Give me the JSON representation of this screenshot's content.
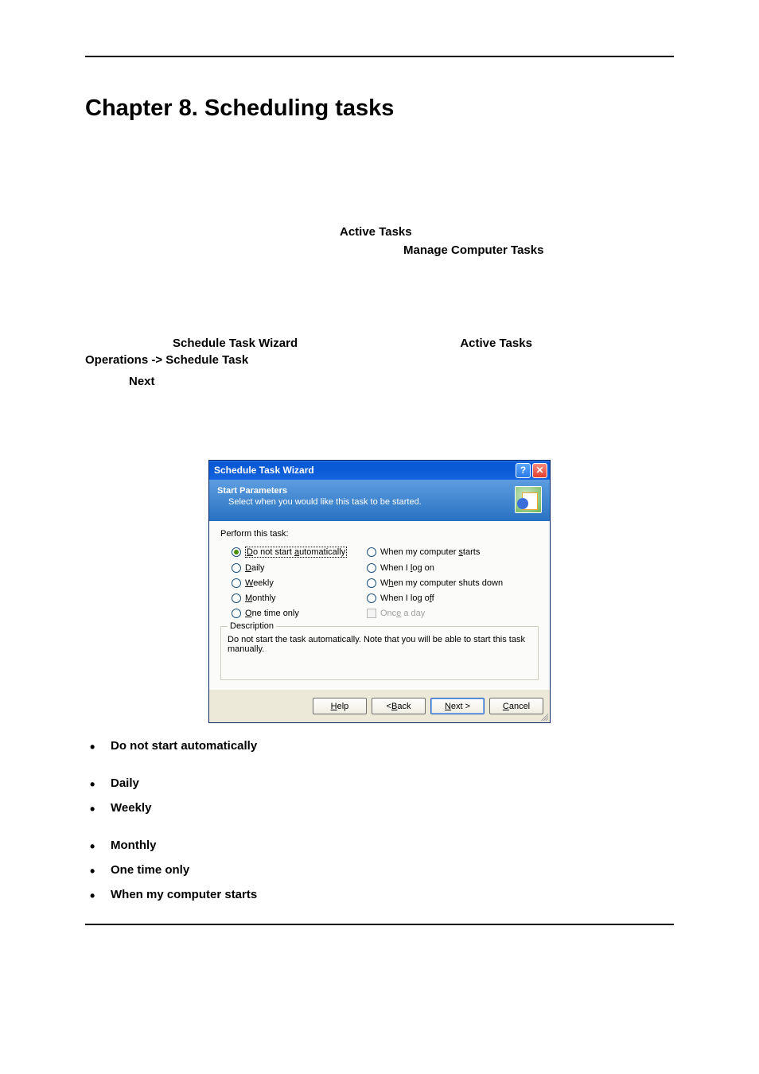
{
  "heading": "Chapter 8.  Scheduling tasks",
  "text": {
    "active_tasks": "Active  Tasks",
    "manage": "Manage  Computer  Tasks",
    "wizard_b1": "Schedule Task Wizard",
    "wizard_b2": "Active Tasks",
    "ops": "Operations -> Schedule Task",
    "next": "Next"
  },
  "dialog": {
    "title": "Schedule Task Wizard",
    "header_title": "Start Parameters",
    "header_sub": "Select when you would like this task to be started.",
    "perform_label": "Perform this task:",
    "radios": {
      "r0": "Do not start automatically",
      "r1": "Daily",
      "r2": "Weekly",
      "r3": "Monthly",
      "r4": "One time only",
      "r5": "When my computer starts",
      "r6": "When I log on",
      "r7": "When my computer shuts down",
      "r8": "When I log off"
    },
    "checkbox": "Once a day",
    "group_label": "Description",
    "desc": "Do not start the task automatically. Note that you will be able to start this task manually.",
    "buttons": {
      "help": "Help",
      "back": "< Back",
      "next": "Next >",
      "cancel": "Cancel"
    }
  },
  "bullets": {
    "b0": "Do not start automatically",
    "b1": "Daily",
    "b2": "Weekly",
    "b3": "Monthly",
    "b4": "One time only",
    "b5": "When my computer starts"
  }
}
